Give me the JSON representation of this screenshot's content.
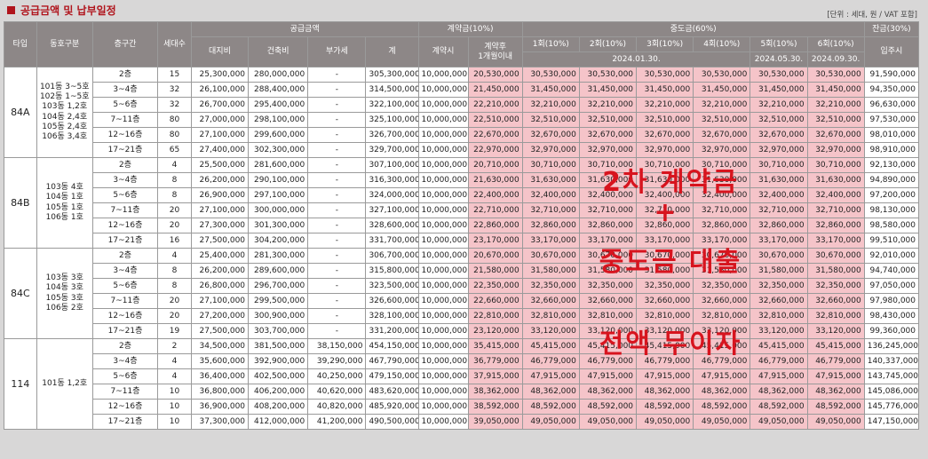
{
  "title": "공급금액 및 납부일정",
  "unit_note": "[단위 : 세대, 원 / VAT 포함]",
  "headers": {
    "type": "타입",
    "dong": "동호구분",
    "floor": "층구간",
    "units": "세대수",
    "supply_group": "공급금액",
    "land": "대지비",
    "building": "건축비",
    "vat": "부가세",
    "total": "계",
    "contract_group": "계약금(10%)",
    "contract_at": "계약시",
    "contract_after": "계약후\n1개월이내",
    "mid_group": "중도금(60%)",
    "mid": [
      "1회(10%)",
      "2회(10%)",
      "3회(10%)",
      "4회(10%)",
      "5회(10%)",
      "6회(10%)"
    ],
    "mid_dates": [
      "2024.01.30.",
      "2024.05.30.",
      "2024.09.30."
    ],
    "balance_group": "잔금(30%)",
    "balance": "입주시"
  },
  "groups": [
    {
      "type": "84A",
      "dong": "101동 3~5호\n102동 1~5호\n103동 1,2호\n104동 2,4호\n105동 2,4호\n106동 3,4호",
      "rows": [
        [
          "2층",
          "15",
          "25,300,000",
          "280,000,000",
          "-",
          "305,300,000",
          "10,000,000",
          "20,530,000",
          "30,530,000",
          "30,530,000",
          "30,530,000",
          "30,530,000",
          "30,530,000",
          "30,530,000",
          "91,590,000"
        ],
        [
          "3~4층",
          "32",
          "26,100,000",
          "288,400,000",
          "-",
          "314,500,000",
          "10,000,000",
          "21,450,000",
          "31,450,000",
          "31,450,000",
          "31,450,000",
          "31,450,000",
          "31,450,000",
          "31,450,000",
          "94,350,000"
        ],
        [
          "5~6층",
          "32",
          "26,700,000",
          "295,400,000",
          "-",
          "322,100,000",
          "10,000,000",
          "22,210,000",
          "32,210,000",
          "32,210,000",
          "32,210,000",
          "32,210,000",
          "32,210,000",
          "32,210,000",
          "96,630,000"
        ],
        [
          "7~11층",
          "80",
          "27,000,000",
          "298,100,000",
          "-",
          "325,100,000",
          "10,000,000",
          "22,510,000",
          "32,510,000",
          "32,510,000",
          "32,510,000",
          "32,510,000",
          "32,510,000",
          "32,510,000",
          "97,530,000"
        ],
        [
          "12~16층",
          "80",
          "27,100,000",
          "299,600,000",
          "-",
          "326,700,000",
          "10,000,000",
          "22,670,000",
          "32,670,000",
          "32,670,000",
          "32,670,000",
          "32,670,000",
          "32,670,000",
          "32,670,000",
          "98,010,000"
        ],
        [
          "17~21층",
          "65",
          "27,400,000",
          "302,300,000",
          "-",
          "329,700,000",
          "10,000,000",
          "22,970,000",
          "32,970,000",
          "32,970,000",
          "32,970,000",
          "32,970,000",
          "32,970,000",
          "32,970,000",
          "98,910,000"
        ]
      ]
    },
    {
      "type": "84B",
      "dong": "103동 4호\n104동 1호\n105동 1호\n106동 1호",
      "rows": [
        [
          "2층",
          "4",
          "25,500,000",
          "281,600,000",
          "-",
          "307,100,000",
          "10,000,000",
          "20,710,000",
          "30,710,000",
          "30,710,000",
          "30,710,000",
          "30,710,000",
          "30,710,000",
          "30,710,000",
          "92,130,000"
        ],
        [
          "3~4층",
          "8",
          "26,200,000",
          "290,100,000",
          "-",
          "316,300,000",
          "10,000,000",
          "21,630,000",
          "31,630,000",
          "31,630,000",
          "31,630,000",
          "31,630,000",
          "31,630,000",
          "31,630,000",
          "94,890,000"
        ],
        [
          "5~6층",
          "8",
          "26,900,000",
          "297,100,000",
          "-",
          "324,000,000",
          "10,000,000",
          "22,400,000",
          "32,400,000",
          "32,400,000",
          "32,400,000",
          "32,400,000",
          "32,400,000",
          "32,400,000",
          "97,200,000"
        ],
        [
          "7~11층",
          "20",
          "27,100,000",
          "300,000,000",
          "-",
          "327,100,000",
          "10,000,000",
          "22,710,000",
          "32,710,000",
          "32,710,000",
          "32,710,000",
          "32,710,000",
          "32,710,000",
          "32,710,000",
          "98,130,000"
        ],
        [
          "12~16층",
          "20",
          "27,300,000",
          "301,300,000",
          "-",
          "328,600,000",
          "10,000,000",
          "22,860,000",
          "32,860,000",
          "32,860,000",
          "32,860,000",
          "32,860,000",
          "32,860,000",
          "32,860,000",
          "98,580,000"
        ],
        [
          "17~21층",
          "16",
          "27,500,000",
          "304,200,000",
          "-",
          "331,700,000",
          "10,000,000",
          "23,170,000",
          "33,170,000",
          "33,170,000",
          "33,170,000",
          "33,170,000",
          "33,170,000",
          "33,170,000",
          "99,510,000"
        ]
      ]
    },
    {
      "type": "84C",
      "dong": "103동 3호\n104동 3호\n105동 3호\n106동 2호",
      "rows": [
        [
          "2층",
          "4",
          "25,400,000",
          "281,300,000",
          "-",
          "306,700,000",
          "10,000,000",
          "20,670,000",
          "30,670,000",
          "30,670,000",
          "30,670,000",
          "30,670,000",
          "30,670,000",
          "30,670,000",
          "92,010,000"
        ],
        [
          "3~4층",
          "8",
          "26,200,000",
          "289,600,000",
          "-",
          "315,800,000",
          "10,000,000",
          "21,580,000",
          "31,580,000",
          "31,580,000",
          "31,580,000",
          "31,580,000",
          "31,580,000",
          "31,580,000",
          "94,740,000"
        ],
        [
          "5~6층",
          "8",
          "26,800,000",
          "296,700,000",
          "-",
          "323,500,000",
          "10,000,000",
          "22,350,000",
          "32,350,000",
          "32,350,000",
          "32,350,000",
          "32,350,000",
          "32,350,000",
          "32,350,000",
          "97,050,000"
        ],
        [
          "7~11층",
          "20",
          "27,100,000",
          "299,500,000",
          "-",
          "326,600,000",
          "10,000,000",
          "22,660,000",
          "32,660,000",
          "32,660,000",
          "32,660,000",
          "32,660,000",
          "32,660,000",
          "32,660,000",
          "97,980,000"
        ],
        [
          "12~16층",
          "20",
          "27,200,000",
          "300,900,000",
          "-",
          "328,100,000",
          "10,000,000",
          "22,810,000",
          "32,810,000",
          "32,810,000",
          "32,810,000",
          "32,810,000",
          "32,810,000",
          "32,810,000",
          "98,430,000"
        ],
        [
          "17~21층",
          "19",
          "27,500,000",
          "303,700,000",
          "-",
          "331,200,000",
          "10,000,000",
          "23,120,000",
          "33,120,000",
          "33,120,000",
          "33,120,000",
          "33,120,000",
          "33,120,000",
          "33,120,000",
          "99,360,000"
        ]
      ]
    },
    {
      "type": "114",
      "dong": "101동 1,2호",
      "rows": [
        [
          "2층",
          "2",
          "34,500,000",
          "381,500,000",
          "38,150,000",
          "454,150,000",
          "10,000,000",
          "35,415,000",
          "45,415,000",
          "45,415,000",
          "45,415,000",
          "45,415,000",
          "45,415,000",
          "45,415,000",
          "136,245,000"
        ],
        [
          "3~4층",
          "4",
          "35,600,000",
          "392,900,000",
          "39,290,000",
          "467,790,000",
          "10,000,000",
          "36,779,000",
          "46,779,000",
          "46,779,000",
          "46,779,000",
          "46,779,000",
          "46,779,000",
          "46,779,000",
          "140,337,000"
        ],
        [
          "5~6층",
          "4",
          "36,400,000",
          "402,500,000",
          "40,250,000",
          "479,150,000",
          "10,000,000",
          "37,915,000",
          "47,915,000",
          "47,915,000",
          "47,915,000",
          "47,915,000",
          "47,915,000",
          "47,915,000",
          "143,745,000"
        ],
        [
          "7~11층",
          "10",
          "36,800,000",
          "406,200,000",
          "40,620,000",
          "483,620,000",
          "10,000,000",
          "38,362,000",
          "48,362,000",
          "48,362,000",
          "48,362,000",
          "48,362,000",
          "48,362,000",
          "48,362,000",
          "145,086,000"
        ],
        [
          "12~16층",
          "10",
          "36,900,000",
          "408,200,000",
          "40,820,000",
          "485,920,000",
          "10,000,000",
          "38,592,000",
          "48,592,000",
          "48,592,000",
          "48,592,000",
          "48,592,000",
          "48,592,000",
          "48,592,000",
          "145,776,000"
        ],
        [
          "17~21층",
          "10",
          "37,300,000",
          "412,000,000",
          "41,200,000",
          "490,500,000",
          "10,000,000",
          "39,050,000",
          "49,050,000",
          "49,050,000",
          "49,050,000",
          "49,050,000",
          "49,050,000",
          "49,050,000",
          "147,150,000"
        ]
      ]
    }
  ],
  "overlay": {
    "line1": "2차 계약금",
    "line2": "+",
    "line3": "중도금 대출",
    "line4": "전액 무이자"
  },
  "colors": {
    "accent": "#b0141c",
    "header_bg": "#8d8787",
    "highlight": "#f5c4c9",
    "overlay_text": "#d7141e"
  }
}
